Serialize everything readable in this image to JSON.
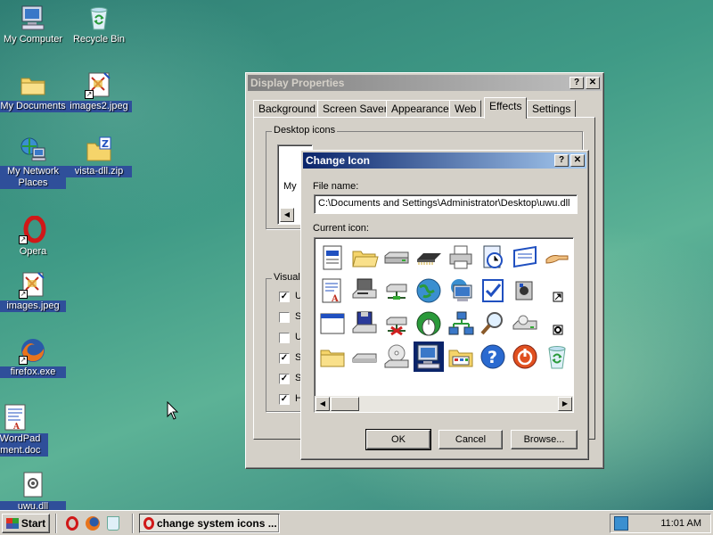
{
  "desktop": {
    "icons": [
      {
        "label": "My Computer",
        "icon": "my-computer-icon"
      },
      {
        "label": "Recycle Bin",
        "icon": "recycle-bin-icon"
      },
      {
        "label": "My Documents",
        "icon": "folder-icon"
      },
      {
        "label": "images2.jpeg",
        "icon": "image-file-icon"
      },
      {
        "label": "My Network",
        "label2": "Places",
        "icon": "network-places-icon"
      },
      {
        "label": "vista-dll.zip",
        "icon": "zip-folder-icon"
      },
      {
        "label": "Opera",
        "icon": "opera-icon"
      },
      {
        "label": "images.jpeg",
        "icon": "image-file-icon"
      },
      {
        "label": "firefox.exe",
        "icon": "firefox-icon"
      },
      {
        "label": "w WordPad",
        "label2": "cument.doc",
        "icon": "wordpad-doc-icon"
      },
      {
        "label": "uwu.dll",
        "icon": "dll-file-icon"
      }
    ]
  },
  "display_properties": {
    "title": "Display Properties",
    "help_btn": "?",
    "close_btn": "✕",
    "tabs": [
      "Background",
      "Screen Saver",
      "Appearance",
      "Web",
      "Effects",
      "Settings"
    ],
    "active_tab": "Effects",
    "desktop_icons_label": "Desktop icons",
    "desktop_icon_partial": "My",
    "visual_label": "Visual",
    "checks": [
      {
        "text": "U",
        "checked": "✓"
      },
      {
        "text": "S",
        "checked": ""
      },
      {
        "text": "U",
        "checked": ""
      },
      {
        "text": "S",
        "checked": "✓"
      },
      {
        "text": "S",
        "checked": "✓"
      },
      {
        "text": "H",
        "checked": "✓"
      }
    ]
  },
  "change_icon": {
    "title": "Change Icon",
    "help_btn": "?",
    "close_btn": "✕",
    "file_name_label": "File name:",
    "file_name_value": "C:\\Documents and Settings\\Administrator\\Desktop\\uwu.dll",
    "current_icon_label": "Current icon:",
    "ok_label": "OK",
    "cancel_label": "Cancel",
    "browse_label": "Browse...",
    "icons": [
      "document-icon",
      "folder-open-icon",
      "drive-icon",
      "memory-chip-icon",
      "printer-icon",
      "clock-doc-icon",
      "window-dash-icon",
      "hand-share-icon",
      "wordpad-icon",
      "floppy-drive-icon",
      "network-drive-icon",
      "globe-icon",
      "monitor-globe-icon",
      "checkbox-task-icon",
      "speaker-icon",
      "shortcut-arrow-icon",
      "window-icon",
      "floppy-disk-icon",
      "disconnected-drive-icon",
      "globe-mouse-icon",
      "network-icon",
      "search-icon",
      "drive-cd-icon",
      "dot-overlay-icon",
      "folder-icon",
      "hard-drive-icon",
      "cd-drive-icon",
      "my-computer-icon",
      "control-panel-icon",
      "help-icon",
      "power-icon",
      "recycle-bin-icon"
    ]
  },
  "taskbar": {
    "start_label": "Start",
    "task_label": "change system icons ...",
    "clock": "11:01 AM"
  },
  "colors": {
    "title_active": "#0a246a",
    "title_inactive": "#808080",
    "face": "#d4d0c8"
  }
}
